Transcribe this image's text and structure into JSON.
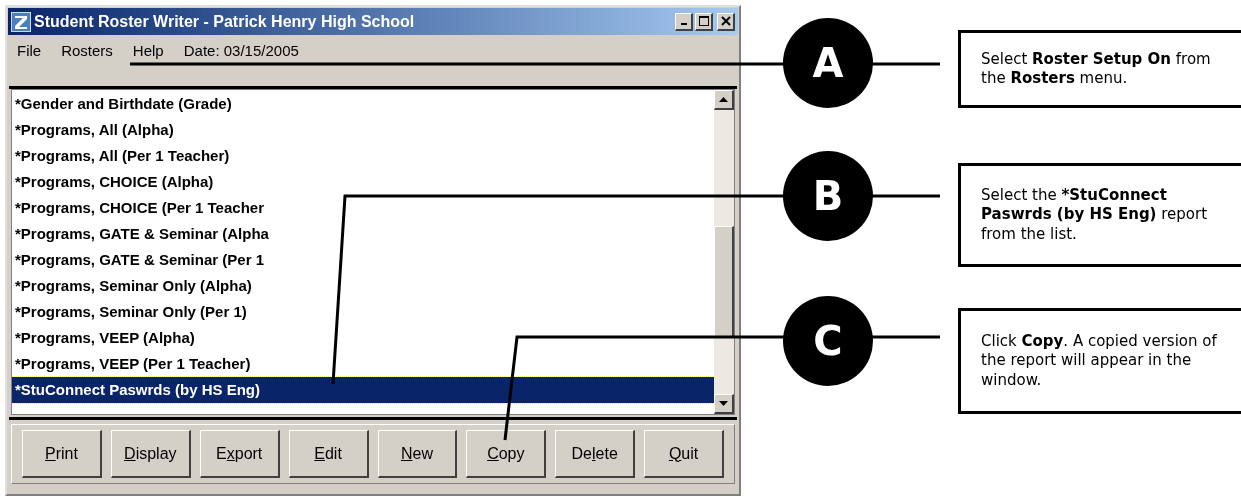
{
  "window": {
    "title": "Student Roster Writer - Patrick Henry High School"
  },
  "menu": [
    "File",
    "Rosters",
    "Help",
    "Date: 03/15/2005"
  ],
  "list": [
    {
      "label": "*Gender and Birthdate (Grade)",
      "selected": false
    },
    {
      "label": "*Programs, All (Alpha)",
      "selected": false
    },
    {
      "label": "*Programs, All (Per 1 Teacher)",
      "selected": false
    },
    {
      "label": "*Programs, CHOICE (Alpha)",
      "selected": false
    },
    {
      "label": "*Programs, CHOICE (Per 1 Teacher",
      "selected": false
    },
    {
      "label": "*Programs, GATE & Seminar (Alpha",
      "selected": false
    },
    {
      "label": "*Programs, GATE & Seminar (Per 1",
      "selected": false
    },
    {
      "label": "*Programs, Seminar Only (Alpha)",
      "selected": false
    },
    {
      "label": "*Programs, Seminar Only (Per 1)",
      "selected": false
    },
    {
      "label": "*Programs, VEEP (Alpha)",
      "selected": false
    },
    {
      "label": "*Programs, VEEP (Per 1 Teacher)",
      "selected": false
    },
    {
      "label": "*StuConnect Paswrds (by HS Eng)",
      "selected": true
    }
  ],
  "buttons": [
    {
      "key": "P",
      "post": "rint"
    },
    {
      "key": "D",
      "post": "isplay"
    },
    {
      "pre": "E",
      "key": "x",
      "post": "port"
    },
    {
      "key": "E",
      "post": "dit"
    },
    {
      "key": "N",
      "post": "ew"
    },
    {
      "key": "C",
      "post": "opy"
    },
    {
      "pre": "De",
      "key": "l",
      "post": "ete"
    },
    {
      "key": "Q",
      "post": "uit"
    }
  ],
  "callouts": [
    {
      "letter": "A",
      "text": "Select **Roster Setup On** from the **Rosters** menu."
    },
    {
      "letter": "B",
      "text": "Select the ***StuConnect Paswrds (by HS Eng)** report from the list."
    },
    {
      "letter": "C",
      "text": "Click **Copy**. A copied version of the report will appear in the window."
    }
  ]
}
